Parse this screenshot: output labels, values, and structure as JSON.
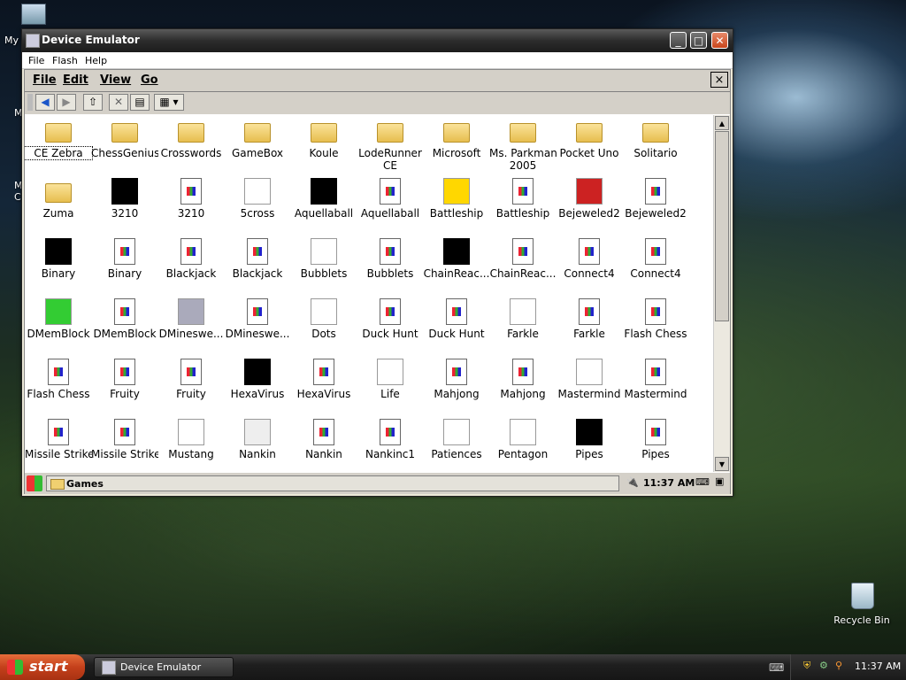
{
  "desktop": {
    "top_icon_label": "My",
    "left_partial_1": "M",
    "left_partial_2": "M",
    "left_partial_3": "C",
    "recycle_bin": "Recycle Bin"
  },
  "window": {
    "title": "Device Emulator",
    "menu": [
      "File",
      "Flash",
      "Help"
    ]
  },
  "device": {
    "menu": [
      "File",
      "Edit",
      "View",
      "Go"
    ],
    "close_label": "×",
    "items": [
      {
        "label": "CE Zebra",
        "icon": "folder-icon"
      },
      {
        "label": "ChessGenius",
        "icon": "folder-icon"
      },
      {
        "label": "Crosswords",
        "icon": "folder-icon"
      },
      {
        "label": "GameBox",
        "icon": "folder-icon"
      },
      {
        "label": "Koule",
        "icon": "folder-icon"
      },
      {
        "label": "LodeRunner\nCE",
        "icon": "folder-icon"
      },
      {
        "label": "Microsoft",
        "icon": "folder-icon"
      },
      {
        "label": "Ms. Parkman\n2005",
        "icon": "folder-icon"
      },
      {
        "label": "Pocket Uno",
        "icon": "folder-icon"
      },
      {
        "label": "Solitario",
        "icon": "folder-icon"
      },
      {
        "label": "Zuma",
        "icon": "folder-icon"
      },
      {
        "label": "3210",
        "icon": "game-3210-icon"
      },
      {
        "label": "3210",
        "icon": "shortcut-icon"
      },
      {
        "label": "5cross",
        "icon": "grid-icon"
      },
      {
        "label": "Aquellaball",
        "icon": "ball-icon"
      },
      {
        "label": "Aquellaball",
        "icon": "shortcut-icon"
      },
      {
        "label": "Battleship",
        "icon": "explosion-icon"
      },
      {
        "label": "Battleship",
        "icon": "shortcut-icon"
      },
      {
        "label": "Bejeweled2",
        "icon": "gem-icon"
      },
      {
        "label": "Bejeweled2",
        "icon": "shortcut-icon"
      },
      {
        "label": "Binary",
        "icon": "binary-icon"
      },
      {
        "label": "Binary",
        "icon": "shortcut-icon"
      },
      {
        "label": "Blackjack",
        "icon": "shortcut-icon"
      },
      {
        "label": "Blackjack",
        "icon": "shortcut-icon"
      },
      {
        "label": "Bubblets",
        "icon": "bubbles-icon"
      },
      {
        "label": "Bubblets",
        "icon": "shortcut-icon"
      },
      {
        "label": "ChainReac...",
        "icon": "chain-icon"
      },
      {
        "label": "ChainReac...",
        "icon": "shortcut-icon"
      },
      {
        "label": "Connect4",
        "icon": "shortcut-icon"
      },
      {
        "label": "Connect4",
        "icon": "shortcut-icon"
      },
      {
        "label": "DMemBlock",
        "icon": "blocks-icon"
      },
      {
        "label": "DMemBlock",
        "icon": "shortcut-icon"
      },
      {
        "label": "DMineswe...",
        "icon": "mine-icon"
      },
      {
        "label": "DMineswe...",
        "icon": "shortcut-icon"
      },
      {
        "label": "Dots",
        "icon": "dots-icon"
      },
      {
        "label": "Duck Hunt",
        "icon": "shortcut-icon"
      },
      {
        "label": "Duck Hunt",
        "icon": "shortcut-icon"
      },
      {
        "label": "Farkle",
        "icon": "dice-icon"
      },
      {
        "label": "Farkle",
        "icon": "shortcut-icon"
      },
      {
        "label": "Flash Chess",
        "icon": "shortcut-icon"
      },
      {
        "label": "Flash Chess",
        "icon": "shortcut-icon"
      },
      {
        "label": "Fruity",
        "icon": "shortcut-icon"
      },
      {
        "label": "Fruity",
        "icon": "shortcut-icon"
      },
      {
        "label": "HexaVirus",
        "icon": "virus-icon"
      },
      {
        "label": "HexaVirus",
        "icon": "shortcut-icon"
      },
      {
        "label": "Life",
        "icon": "life-icon"
      },
      {
        "label": "Mahjong",
        "icon": "shortcut-icon"
      },
      {
        "label": "Mahjong",
        "icon": "shortcut-icon"
      },
      {
        "label": "Mastermind",
        "icon": "pegs-icon"
      },
      {
        "label": "Mastermind",
        "icon": "shortcut-icon"
      },
      {
        "label": "Missile Strike",
        "icon": "shortcut-icon"
      },
      {
        "label": "Missile Strike",
        "icon": "shortcut-icon"
      },
      {
        "label": "Mustang",
        "icon": "horse-icon"
      },
      {
        "label": "Nankin",
        "icon": "tile-icon"
      },
      {
        "label": "Nankin",
        "icon": "shortcut-icon"
      },
      {
        "label": "Nankinc1",
        "icon": "shortcut-icon"
      },
      {
        "label": "Patiences",
        "icon": "spade-icon"
      },
      {
        "label": "Pentagon",
        "icon": "pentagon-icon"
      },
      {
        "label": "Pipes",
        "icon": "pipes-icon"
      },
      {
        "label": "Pipes",
        "icon": "shortcut-icon"
      }
    ],
    "status_path": "Games",
    "clock": "11:37 AM"
  },
  "taskbar": {
    "start_label": "start",
    "task_label": "Device Emulator",
    "clock": "11:37 AM"
  }
}
